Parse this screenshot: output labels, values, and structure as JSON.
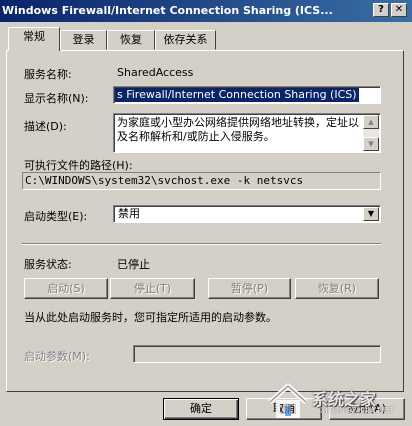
{
  "window": {
    "title": "Windows Firewall/Internet Connection Sharing (ICS...",
    "help_button": "?",
    "close_button": "✕"
  },
  "tabs": [
    {
      "label": "常规",
      "active": true
    },
    {
      "label": "登录",
      "active": false
    },
    {
      "label": "恢复",
      "active": false
    },
    {
      "label": "依存关系",
      "active": false
    }
  ],
  "general": {
    "service_name_label": "服务名称:",
    "service_name_value": "SharedAccess",
    "display_name_label": "显示名称(N):",
    "display_name_value": "s Firewall/Internet Connection Sharing (ICS)",
    "description_label": "描述(D):",
    "description_value": "为家庭或小型办公网络提供网络地址转换，定址以及名称解析和/或防止入侵服务。",
    "exec_path_label": "可执行文件的路径(H):",
    "exec_path_value": "C:\\WINDOWS\\system32\\svchost.exe -k netsvcs",
    "startup_type_label": "启动类型(E):",
    "startup_type_value": "禁用",
    "service_status_label": "服务状态:",
    "service_status_value": "已停止",
    "start_button": "启动(S)",
    "stop_button": "停止(T)",
    "pause_button": "暂停(P)",
    "resume_button": "恢复(R)",
    "hint_text": "当从此处启动服务时，您可指定所适用的启动参数。",
    "start_params_label": "启动参数(M):",
    "start_params_value": ""
  },
  "footer": {
    "ok_button": "确定",
    "cancel_button": "取消",
    "apply_button": "应用(A)"
  },
  "watermark": {
    "text": "系统之家",
    "sub": "XITONGZHIJIA.NET"
  }
}
